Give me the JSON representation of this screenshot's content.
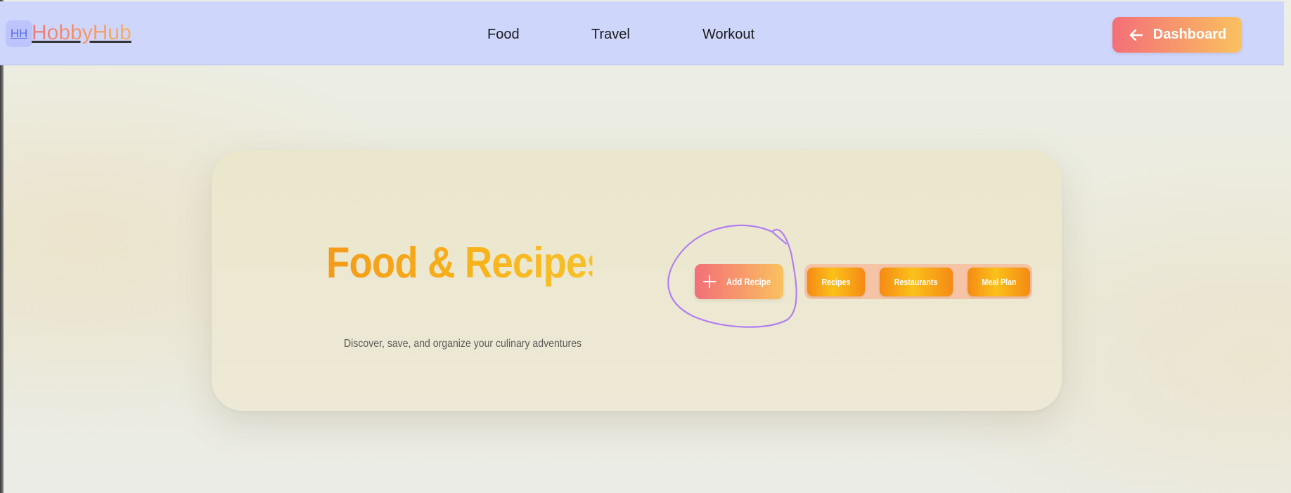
{
  "header": {
    "logo_badge": "HH",
    "logo_text": "HobbyHub",
    "nav": [
      "Food",
      "Travel",
      "Workout"
    ],
    "dashboard_label": "Dashboard",
    "dashboard_icon": "arrow-left-icon"
  },
  "hero": {
    "title": "Food & Recipes",
    "subtitle": "Discover, save, and organize your culinary adventures",
    "add_label": "Add Recipe",
    "add_icon": "plus-icon",
    "tabs": [
      "Recipes",
      "Restaurants",
      "Meal Plan"
    ]
  },
  "colors": {
    "navbar": "#cfd6fb",
    "accent_start": "#f36f78",
    "accent_end": "#fbc15f",
    "title_orange": "#f59a1a",
    "annotation": "#b27ff0"
  }
}
